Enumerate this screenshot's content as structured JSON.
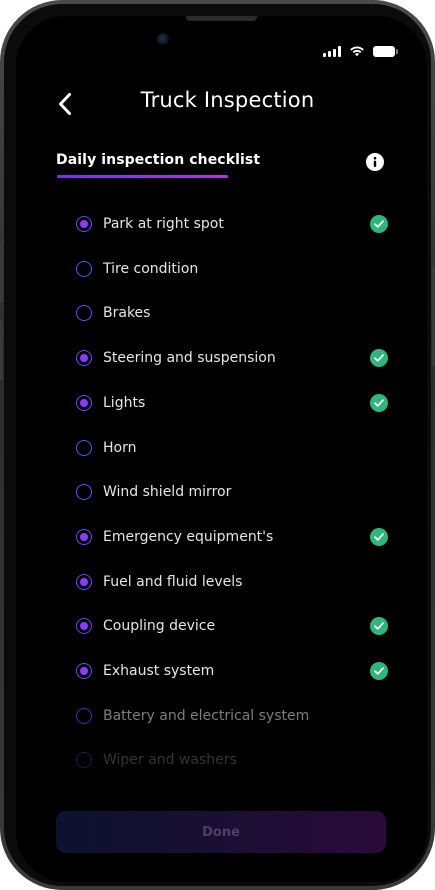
{
  "status_bar": {
    "signal_icon": "cellular-signal-icon",
    "wifi_icon": "wifi-icon",
    "battery_icon": "battery-icon"
  },
  "header": {
    "back_icon": "chevron-left-icon",
    "title": "Truck Inspection"
  },
  "tabs": [
    {
      "label": "Daily inspection checklist",
      "active": true
    }
  ],
  "info_icon": "info-icon",
  "checklist": [
    {
      "label": "Park at right spot",
      "selected": true,
      "verified": true
    },
    {
      "label": "Tire condition",
      "selected": false,
      "verified": false
    },
    {
      "label": "Brakes",
      "selected": false,
      "verified": false
    },
    {
      "label": "Steering and suspension",
      "selected": true,
      "verified": true
    },
    {
      "label": "Lights",
      "selected": true,
      "verified": true
    },
    {
      "label": "Horn",
      "selected": false,
      "verified": false
    },
    {
      "label": "Wind shield mirror",
      "selected": false,
      "verified": false
    },
    {
      "label": "Emergency equipment's",
      "selected": true,
      "verified": true
    },
    {
      "label": "Fuel and fluid levels",
      "selected": true,
      "verified": false
    },
    {
      "label": "Coupling device",
      "selected": true,
      "verified": true
    },
    {
      "label": "Exhaust system",
      "selected": true,
      "verified": true
    },
    {
      "label": "Battery and electrical system",
      "selected": false,
      "verified": false
    },
    {
      "label": "Wiper and washers",
      "selected": false,
      "verified": false
    }
  ],
  "done_button": {
    "label": "Done"
  },
  "colors": {
    "accent": "#8a3bff",
    "radio_border": "#6b47ff",
    "verified": "#2fb67c",
    "background": "#000000"
  }
}
